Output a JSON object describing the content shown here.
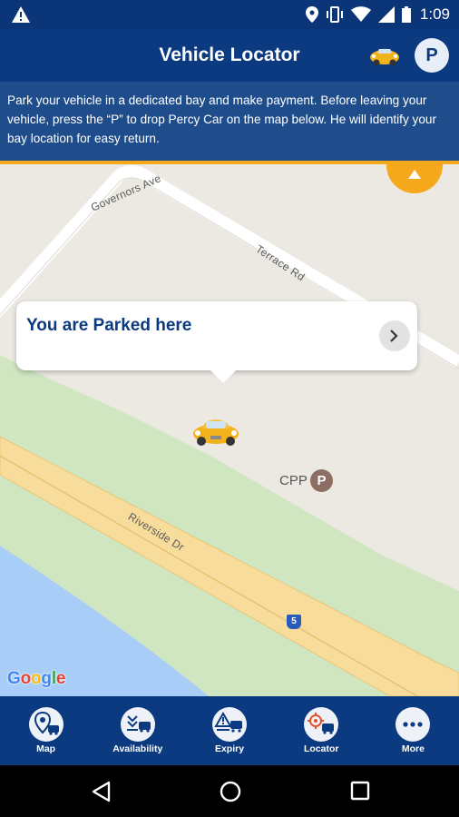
{
  "status_bar": {
    "time": "1:09",
    "icons": [
      "warning-icon",
      "location-icon",
      "vibrate-icon",
      "wifi-icon",
      "signal-icon",
      "battery-icon"
    ]
  },
  "app_bar": {
    "title": "Vehicle Locator",
    "p_button_label": "P"
  },
  "info_banner": {
    "text": "Park your vehicle in a dedicated bay and make payment. Before leaving your vehicle, press the “P” to drop Percy Car on the map below. He will identify your bay location  for easy return."
  },
  "map": {
    "roads": {
      "governors": "Governors Ave",
      "terrace": "Terrace Rd",
      "riverside": "Riverside Dr"
    },
    "callout_text": "You are Parked here",
    "cpp_label": "CPP",
    "cpp_p": "P",
    "route_shield": "5",
    "google_logo": [
      "G",
      "o",
      "o",
      "g",
      "l",
      "e"
    ],
    "colors": {
      "park": "#cfe6c1",
      "water": "#a8cdf7",
      "highway": "#f7dc9c",
      "land": "#ece9e3"
    }
  },
  "bottom_nav": {
    "items": [
      {
        "label": "Map",
        "icon": "map-pin-car-icon"
      },
      {
        "label": "Availability",
        "icon": "availability-icon"
      },
      {
        "label": "Expiry",
        "icon": "expiry-icon"
      },
      {
        "label": "Locator",
        "icon": "locator-icon"
      },
      {
        "label": "More",
        "icon": "more-icon"
      }
    ]
  },
  "colors": {
    "primary": "#0b3a80",
    "accent": "#f5a81c",
    "banner": "#1f4c8a"
  }
}
